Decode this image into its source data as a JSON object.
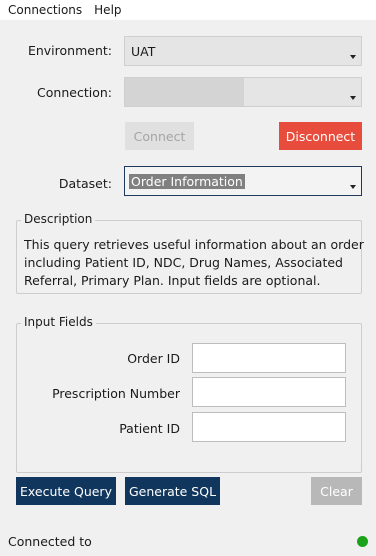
{
  "menu": {
    "items": [
      "Connections",
      "Help"
    ]
  },
  "form": {
    "environment_label": "Environment:",
    "environment_value": "UAT",
    "connection_label": "Connection:",
    "connection_value": "",
    "connect_label": "Connect",
    "disconnect_label": "Disconnect",
    "dataset_label": "Dataset:",
    "dataset_value": "Order Information"
  },
  "description": {
    "title": "Description",
    "text": "This query retrieves useful information about an order including Patient ID, NDC, Drug Names, Associated Referral, Primary Plan. Input fields are optional."
  },
  "input_fields": {
    "title": "Input Fields",
    "fields": [
      {
        "label": "Order ID",
        "value": ""
      },
      {
        "label": "Prescription Number",
        "value": ""
      },
      {
        "label": "Patient ID",
        "value": ""
      }
    ]
  },
  "actions": {
    "execute_label": "Execute Query",
    "generate_label": "Generate SQL",
    "clear_label": "Clear"
  },
  "status": {
    "text": "Connected to",
    "indicator_color": "#1aa31a"
  },
  "colors": {
    "disconnect": "#e74c3c",
    "primary": "#10365e",
    "disabled": "#b8b8b8"
  }
}
